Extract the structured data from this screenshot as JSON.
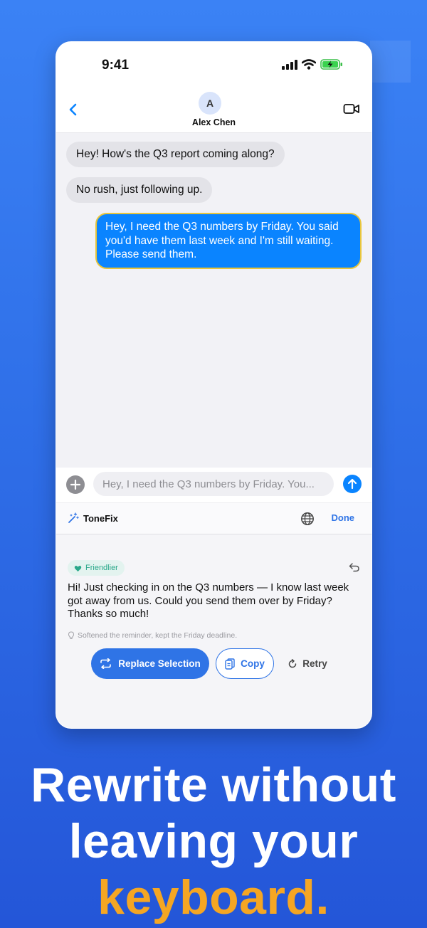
{
  "colors": {
    "background": "#2f6fe8",
    "accent": "#f5a623",
    "imessage_blue": "#0a84ff",
    "primary_button": "#2f74e6",
    "highlight_border": "#e8c53b",
    "tone_green": "#2aa88a"
  },
  "status_bar": {
    "time": "9:41",
    "icons": [
      "signal-icon",
      "wifi-icon",
      "battery-charging-icon"
    ]
  },
  "chat_header": {
    "avatar_initial": "A",
    "contact_name": "Alex Chen",
    "icons": [
      "chevron-left-icon",
      "video-camera-icon"
    ]
  },
  "messages": [
    {
      "direction": "incoming",
      "text": "Hey! How's the Q3 report coming along?"
    },
    {
      "direction": "incoming",
      "text": "No rush, just following up."
    },
    {
      "direction": "outgoing",
      "selected": true,
      "text": "Hey, I need the Q3 numbers by Friday. You said you'd have them last week and I'm still waiting. Please send them."
    }
  ],
  "input_bar": {
    "value": "Hey, I need the Q3 numbers by Friday. You...",
    "icons": [
      "plus-icon",
      "arrow-up-icon"
    ]
  },
  "keyboard_toolbar": {
    "brand_name": "ToneFix",
    "done_label": "Done",
    "icons": [
      "magic-wand-icon",
      "globe-icon"
    ]
  },
  "suggestion": {
    "tone_label": "Friendlier",
    "rewrite": "Hi! Just checking in on the Q3 numbers — I know last week got away from us. Could you send them over by Friday? Thanks so much!",
    "hint": "Softened the reminder, kept the Friday deadline.",
    "icons": [
      "heart-hands-icon",
      "undo-icon",
      "lightbulb-icon"
    ]
  },
  "actions": {
    "replace_label": "Replace Selection",
    "copy_label": "Copy",
    "retry_label": "Retry",
    "icons": [
      "swap-icon",
      "copy-icon",
      "retry-icon"
    ]
  },
  "headline": {
    "line1": "Rewrite without",
    "line2": "leaving your",
    "accent": "keyboard."
  }
}
